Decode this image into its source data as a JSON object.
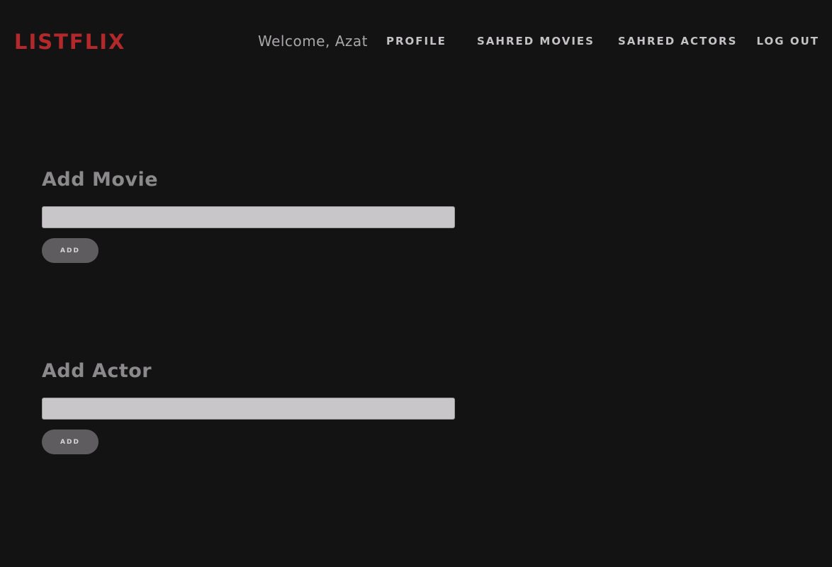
{
  "header": {
    "brand": "LISTFLIX",
    "welcome": "Welcome, Azat",
    "nav": {
      "profile": "PROFILE",
      "shared_movies": "SAHRED MOVIES",
      "shared_actors": "SAHRED ACTORS",
      "logout": "LOG OUT"
    }
  },
  "add_movie": {
    "title": "Add Movie",
    "input_value": "",
    "button_label": "ADD"
  },
  "add_actor": {
    "title": "Add Actor",
    "input_value": "",
    "button_label": "ADD"
  },
  "colors": {
    "background": "#141314",
    "brand": "#b3282b",
    "input_background": "#c8c6c8",
    "button_background": "#5e5c5e"
  }
}
